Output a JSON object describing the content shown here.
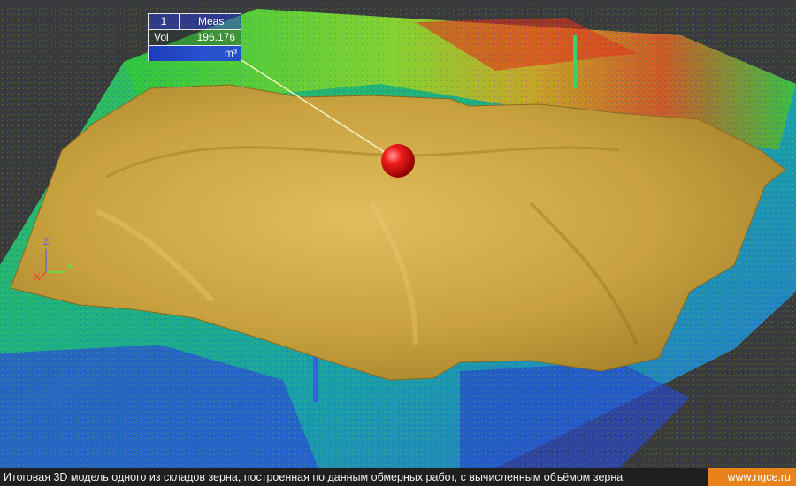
{
  "measurement": {
    "id": "1",
    "title": "Meas",
    "vol_label": "Vol",
    "vol_value": "196.176",
    "vol_unit": "m³"
  },
  "axes": {
    "z": "Z",
    "y": "Y",
    "x": "X"
  },
  "caption": {
    "text": "Итоговая 3D модель одного из складов зерна, построенная по данным обмерных работ, с вычисленным объёмом зерна",
    "site": "www.ngce.ru"
  },
  "colors": {
    "grain_surface": "#c9a23f",
    "marker": "#e01515",
    "accent_badge": "#e9821a"
  }
}
